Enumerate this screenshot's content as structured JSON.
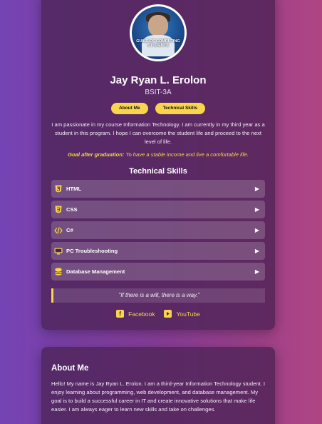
{
  "profile": {
    "name": "Jay Ryan L. Erolon",
    "section": "BSIT-3A",
    "avatar_caption": "GUILD OF COMPUTING STUDENTS",
    "buttons": {
      "about": "About Me",
      "skills": "Technical Skills"
    },
    "bio": "I am passionate in my course Information Technology. I am currently in my third year as a student in this program. I hope I can overcome the student life and proceed to the next level of life.",
    "goal_label": "Goal after graduation:",
    "goal_text": " To have a stable income and live a comfortable life.",
    "skills_title": "Technical Skills",
    "skills": [
      {
        "label": "HTML",
        "icon": "html5-icon"
      },
      {
        "label": "CSS",
        "icon": "css3-icon"
      },
      {
        "label": "C#",
        "icon": "code-icon"
      },
      {
        "label": "PC Troubleshooting",
        "icon": "monitor-icon"
      },
      {
        "label": "Database Management",
        "icon": "database-icon"
      }
    ],
    "quote": "\"If there is a will, there is a way.\"",
    "social": {
      "facebook": "Facebook",
      "youtube": "YouTube"
    }
  },
  "about": {
    "title": "About Me",
    "text": "Hello! My name is Jay Ryan L. Erolon. I am a third-year Information Technology student. I enjoy learning about programming, web development, and database management. My goal is to build a successful career in IT and create innovative solutions that make life easier. I am always eager to learn new skills and take on challenges."
  },
  "colors": {
    "accent": "#f8d54a",
    "card": "#4b2355"
  }
}
